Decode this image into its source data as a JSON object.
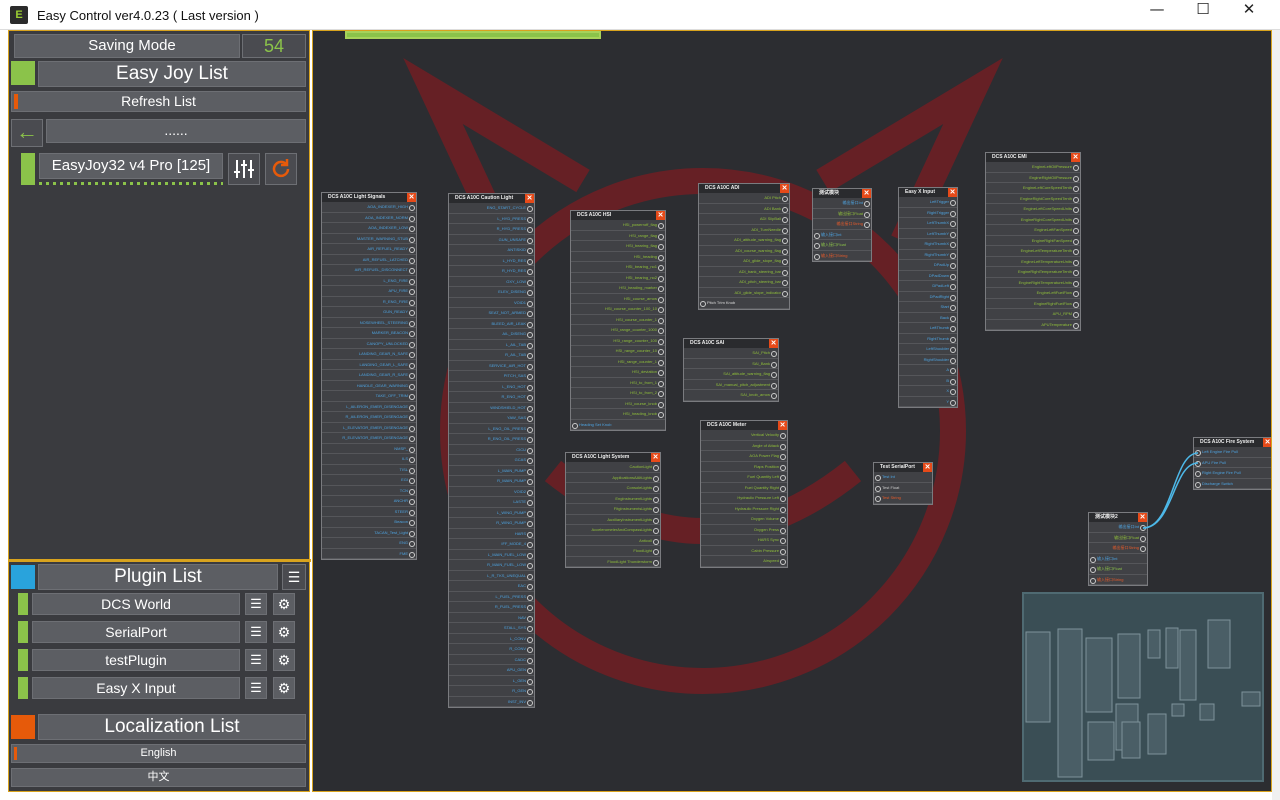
{
  "window": {
    "title": "Easy Control ver4.0.23 ( Last version )",
    "minimize": "—",
    "maximize": "☐",
    "close": "✕"
  },
  "saving_mode": {
    "label": "Saving Mode",
    "value": "54"
  },
  "joy": {
    "header": "Easy Joy List",
    "refresh": "Refresh List",
    "path": "......",
    "device": "EasyJoy32 v4 Pro [125]"
  },
  "plugins": {
    "header": "Plugin List",
    "items": [
      "DCS World",
      "SerialPort",
      "testPlugin",
      "Easy X Input"
    ]
  },
  "localization": {
    "header": "Localization List",
    "items": [
      "English",
      "中文"
    ]
  },
  "nodes": {
    "light_signals": {
      "title": "DCS A10C Light Signals",
      "rows": [
        "AOA_INDEXER_HIGH",
        "AOA_INDEXER_NORM",
        "AOA_INDEXER_LOW",
        "MASTER_WARNING_STUB",
        "AIR_REFUEL_READY",
        "AIR_REFUEL_LATCHED",
        "AIR_REFUEL_DISCONNECT",
        "L_ENG_FIRE",
        "APU_FIRE",
        "R_ENG_FIRE",
        "GUN_READY",
        "NOSEWHEEL_STEERING",
        "MARKER_BEACON",
        "CANOPY_UNLOCKED",
        "LANDING_GEAR_N_SAFE",
        "LANDING_GEAR_L_SAFE",
        "LANDING_GEAR_R_SAFE",
        "HANDLE_GEAR_WARNING",
        "TAKE_OFF_TRIM",
        "L_AILERON_EMER_DISENGAGE",
        "R_AILERON_EMER_DISENGAGE",
        "L_ELEVATOR_EMER_DISENGAGE",
        "R_ELEVATOR_EMER_DISENGAGE",
        "NMSP_",
        "ILS",
        "TISL",
        "EGI",
        "TCN",
        "ANCHR",
        "STEER",
        "Beacon",
        "TACAN_Test_Light",
        "ENG",
        "FME"
      ]
    },
    "caution_light": {
      "title": "DCS A10C Caution Light",
      "rows": [
        "ENG_START_CYCLE",
        "L_HYD_PRESS",
        "R_HYD_PRESS",
        "GUN_UNSAFE",
        "ANTISKID",
        "L_HYD_RES",
        "R_HYD_RES",
        "OXY_LOW",
        "ELEV_DISENG",
        "VOID1",
        "SEAT_NOT_ARMED",
        "BLEED_AIR_LEAK",
        "AIL_DISENG",
        "L_AIL_TAB",
        "R_AIL_TAB",
        "SERVICE_AIR_HOT",
        "PITCH_SAS",
        "L_ENG_HOT",
        "R_ENG_HOT",
        "WINDSHIELD_HOT",
        "YAW_SAS",
        "L_ENG_OIL_PRESS",
        "R_ENG_OIL_PRESS",
        "CICU",
        "GCAS",
        "L_MAIN_PUMP",
        "R_MAIN_PUMP",
        "VOID2",
        "LASTE",
        "L_WING_PUMP",
        "R_WING_PUMP",
        "HARS",
        "IFF_MODE_4",
        "L_MAIN_FUEL_LOW",
        "R_MAIN_FUEL_LOW",
        "L_R_TKS_UNEQUAL",
        "EAC",
        "L_FUEL_PRESS",
        "R_FUEL_PRESS",
        "NAV",
        "STALL_SYS",
        "L_CONV",
        "R_CONV",
        "CADC",
        "APU_GEN",
        "L_GEN",
        "R_GEN",
        "INST_INV"
      ]
    },
    "hsi": {
      "title": "DCS A10C HSI",
      "rows": [
        "HSI_powerroff_flag",
        "HSI_range_flag",
        "HSI_bearing_flag",
        "HSI_heading",
        "HSI_bearing_no1",
        "HSI_bearing_no2",
        "HSI_heading_marker",
        "HSI_course_arrow",
        "HSI_course_counter_100_10",
        "HSI_course_counter_1",
        "HSI_range_counter_1000",
        "HSI_range_counter_100",
        "HSI_range_counter_10",
        "HSI_range_counter_1",
        "HSI_deviation",
        "HSI_to_from_1",
        "HSI_to_from_2",
        "HSI_course_knob",
        "HSI_heading_knob"
      ],
      "input": "Heading Set Knob"
    },
    "adi": {
      "title": "DCS A10C ADI",
      "rows": [
        "ADI Pitch",
        "ADI Bank",
        "ADI SlipBall",
        "ADI_TurnNeedle",
        "ADI_attitude_warning_flag",
        "ADI_course_warning_flag",
        "ADI_glide_slope_flag",
        "ADI_bank_steering_bar",
        "ADI_pitch_steering_bar",
        "ADI_glide_slope_indicator"
      ],
      "input": "Pitch Trim Knob"
    },
    "sai": {
      "title": "DCS A10C SAI",
      "rows": [
        "SAI_Pitch",
        "SAI_Bank",
        "SAI_attitude_warning_flag",
        "SAI_manual_pitch_adjustment",
        "SAI_knob_arrow"
      ]
    },
    "test_module": {
      "title": "测试模块",
      "outs": [
        "输出接口Int",
        "输出接口Float",
        "输出接口String"
      ],
      "ins": [
        "输入接口Int",
        "输入接口Float",
        "输入接口String"
      ]
    },
    "xinput": {
      "title": "Easy X Input",
      "rows": [
        "LeftTrigger",
        "RightTrigger",
        "LeftThumbX",
        "LeftThumbY",
        "RightThumbX",
        "RightThumbY",
        "DPadUp",
        "DPadDown",
        "DPadLeft",
        "DPadRight",
        "Start",
        "Back",
        "LeftThumb",
        "RightThumb",
        "LeftShoulder",
        "RightShoulder",
        "A",
        "B",
        "X",
        "Y"
      ]
    },
    "emi": {
      "title": "DCS A10C EMI",
      "rows": [
        "EngineLeftOilPressure",
        "EngineRightOilPressure",
        "EngineLeftCoreSpeedTenth",
        "EngineRightCoreSpeedTenth",
        "EngineLeftCoreSpeedUnits",
        "EngineRightCoreSpeedUnits",
        "EngineLeftFanSpeed",
        "EngineRightFanSpeed",
        "EngineLeftTemperatureTenth",
        "EngineLeftTemperatureUnits",
        "EngineRightTemperatureTenth",
        "EngineRightTemperatureUnits",
        "EngineLeftFuelFlow",
        "EngineRightFuelFlow",
        "APU_RPM",
        "APUTemperature"
      ]
    },
    "light_system": {
      "title": "DCS A10C Light System",
      "rows": [
        "CautionLight",
        "ApplicationsAAltLights",
        "ConsoleLights",
        "EngInstrumentLights",
        "FltgInstrumentsLights",
        "AuxiliaryInstrumentLights",
        "AccelerometerAndCompassLights",
        "Anticoll",
        "FloodLight",
        "FloodLight Thunderstorm"
      ]
    },
    "meter": {
      "title": "DCS A10C Meter",
      "rows": [
        "Vertical Velocity",
        "Angle of Attack",
        "AOA Power Flag",
        "Flaps Position",
        "Fuel Quantity Left",
        "Fuel Quantity Right",
        "Hydraulic Pressure Left",
        "Hydraulic Pressure Right",
        "Oxygen Volume",
        "Oxygen Press",
        "HARS Sync",
        "Cabin Pressure",
        "Airspeed"
      ]
    },
    "serial": {
      "title": "Test SerialPort",
      "rows": [
        "Test Int",
        "Test Float",
        "Test String"
      ]
    },
    "fire": {
      "title": "DCS A10C Fire System",
      "rows": [
        "Left Engine Fire Pull",
        "APU Fire Pull",
        "Right Engine Fire Pull",
        "Discharge Switch"
      ]
    },
    "test_module2": {
      "title": "测试模块2",
      "outs": [
        "输出接口Int",
        "输出接口Float",
        "输出接口String"
      ],
      "ins": [
        "输入接口Int",
        "输入接口Float",
        "输入接口String"
      ]
    }
  },
  "colors": {
    "accent_green": "#8bc34a",
    "accent_orange": "#e65a0a",
    "accent_blue": "#29a3dc",
    "accent_yellow": "#e8b010",
    "node_bg": "#3b3c40",
    "canvas_bg": "#2c2d31"
  }
}
